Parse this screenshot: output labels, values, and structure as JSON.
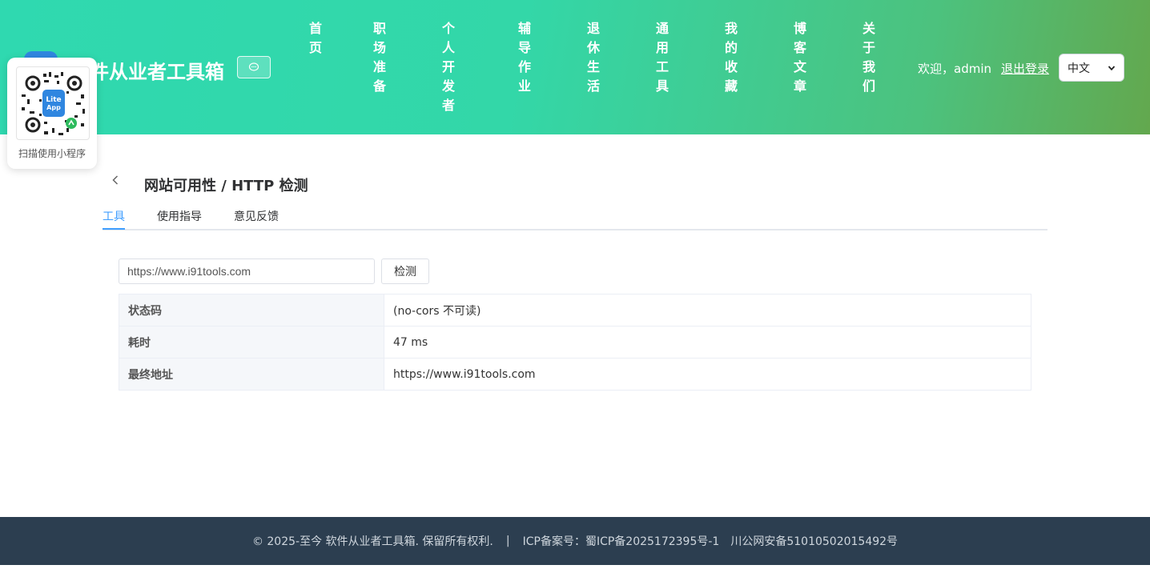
{
  "header": {
    "site_title": "件从业者工具箱",
    "chat_icon": "chat-bubble-icon",
    "nav": [
      {
        "label": "首页"
      },
      {
        "label": "职场准备"
      },
      {
        "label": "个人开发者"
      },
      {
        "label": "辅导作业"
      },
      {
        "label": "退休生活"
      },
      {
        "label": "通用工具"
      },
      {
        "label": "我的收藏"
      },
      {
        "label": "博客文章"
      },
      {
        "label": "关于我们"
      }
    ],
    "welcome": "欢迎，admin",
    "logout": "退出登录",
    "language": "中文"
  },
  "qr": {
    "badge": "Lite App",
    "caption": "扫描使用小程序"
  },
  "main": {
    "title": "网站可用性 / HTTP 检测",
    "tabs": [
      {
        "label": "工具",
        "active": true
      },
      {
        "label": "使用指导",
        "active": false
      },
      {
        "label": "意见反馈",
        "active": false
      }
    ],
    "url_value": "https://www.i91tools.com",
    "check_label": "检测",
    "results": [
      {
        "key": "状态码",
        "value": "(no-cors 不可读)"
      },
      {
        "key": "耗时",
        "value": "47 ms"
      },
      {
        "key": "最终地址",
        "value": "https://www.i91tools.com"
      }
    ]
  },
  "footer": {
    "copyright": "© 2025-至今 软件从业者工具箱. 保留所有权利.",
    "separator": "|",
    "icp": "ICP备案号：蜀ICP备2025172395号-1",
    "police": "川公网安备51010502015492号"
  },
  "colors": {
    "accent": "#409eff",
    "footer_bg": "#2c3e50",
    "header_start": "#2fd9b0",
    "header_end": "#63a84e"
  }
}
